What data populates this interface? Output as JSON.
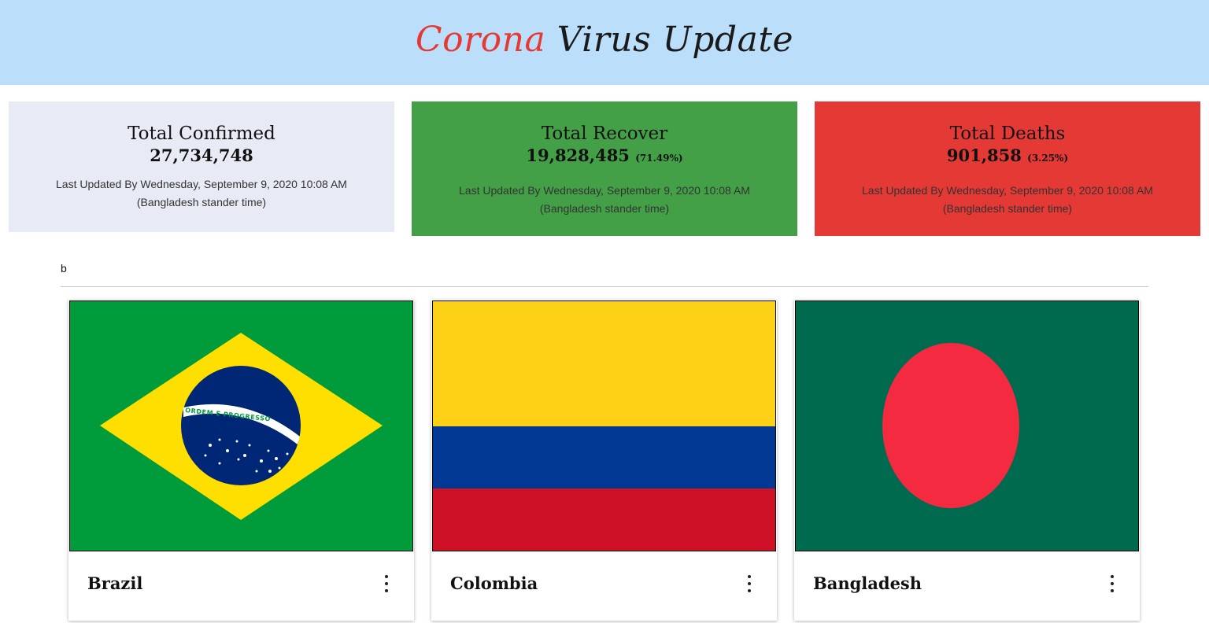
{
  "header": {
    "title_part1": "Corona",
    "title_part2": "Virus Update",
    "title_red": "#e53935",
    "background": "#bbdefb"
  },
  "stats": {
    "confirmed": {
      "title": "Total Confirmed",
      "value": "27,734,748",
      "updated_line1": "Last Updated By Wednesday, September 9, 2020 10:08 AM",
      "updated_line2": "(Bangladesh stander time)",
      "color": "#e8eaf6"
    },
    "recovered": {
      "title": "Total Recover",
      "value": "19,828,485",
      "percent": "(71.49%)",
      "updated_line1": "Last Updated By Wednesday, September 9, 2020 10:08 AM",
      "updated_line2": "(Bangladesh stander time)",
      "color": "#43a047"
    },
    "deaths": {
      "title": "Total Deaths",
      "value": "901,858",
      "percent": "(3.25%)",
      "updated_line1": "Last Updated By Wednesday, September 9, 2020 10:08 AM",
      "updated_line2": "(Bangladesh stander time)",
      "color": "#e53935"
    }
  },
  "section_label": "b",
  "countries": [
    {
      "name": "Brazil",
      "flag_icon": "brazil-flag",
      "menu_icon": "more-vert-icon"
    },
    {
      "name": "Colombia",
      "flag_icon": "colombia-flag",
      "menu_icon": "more-vert-icon"
    },
    {
      "name": "Bangladesh",
      "flag_icon": "bangladesh-flag",
      "menu_icon": "more-vert-icon"
    }
  ],
  "brazil_flag_motto": "ORDEM E PROGRESSO"
}
